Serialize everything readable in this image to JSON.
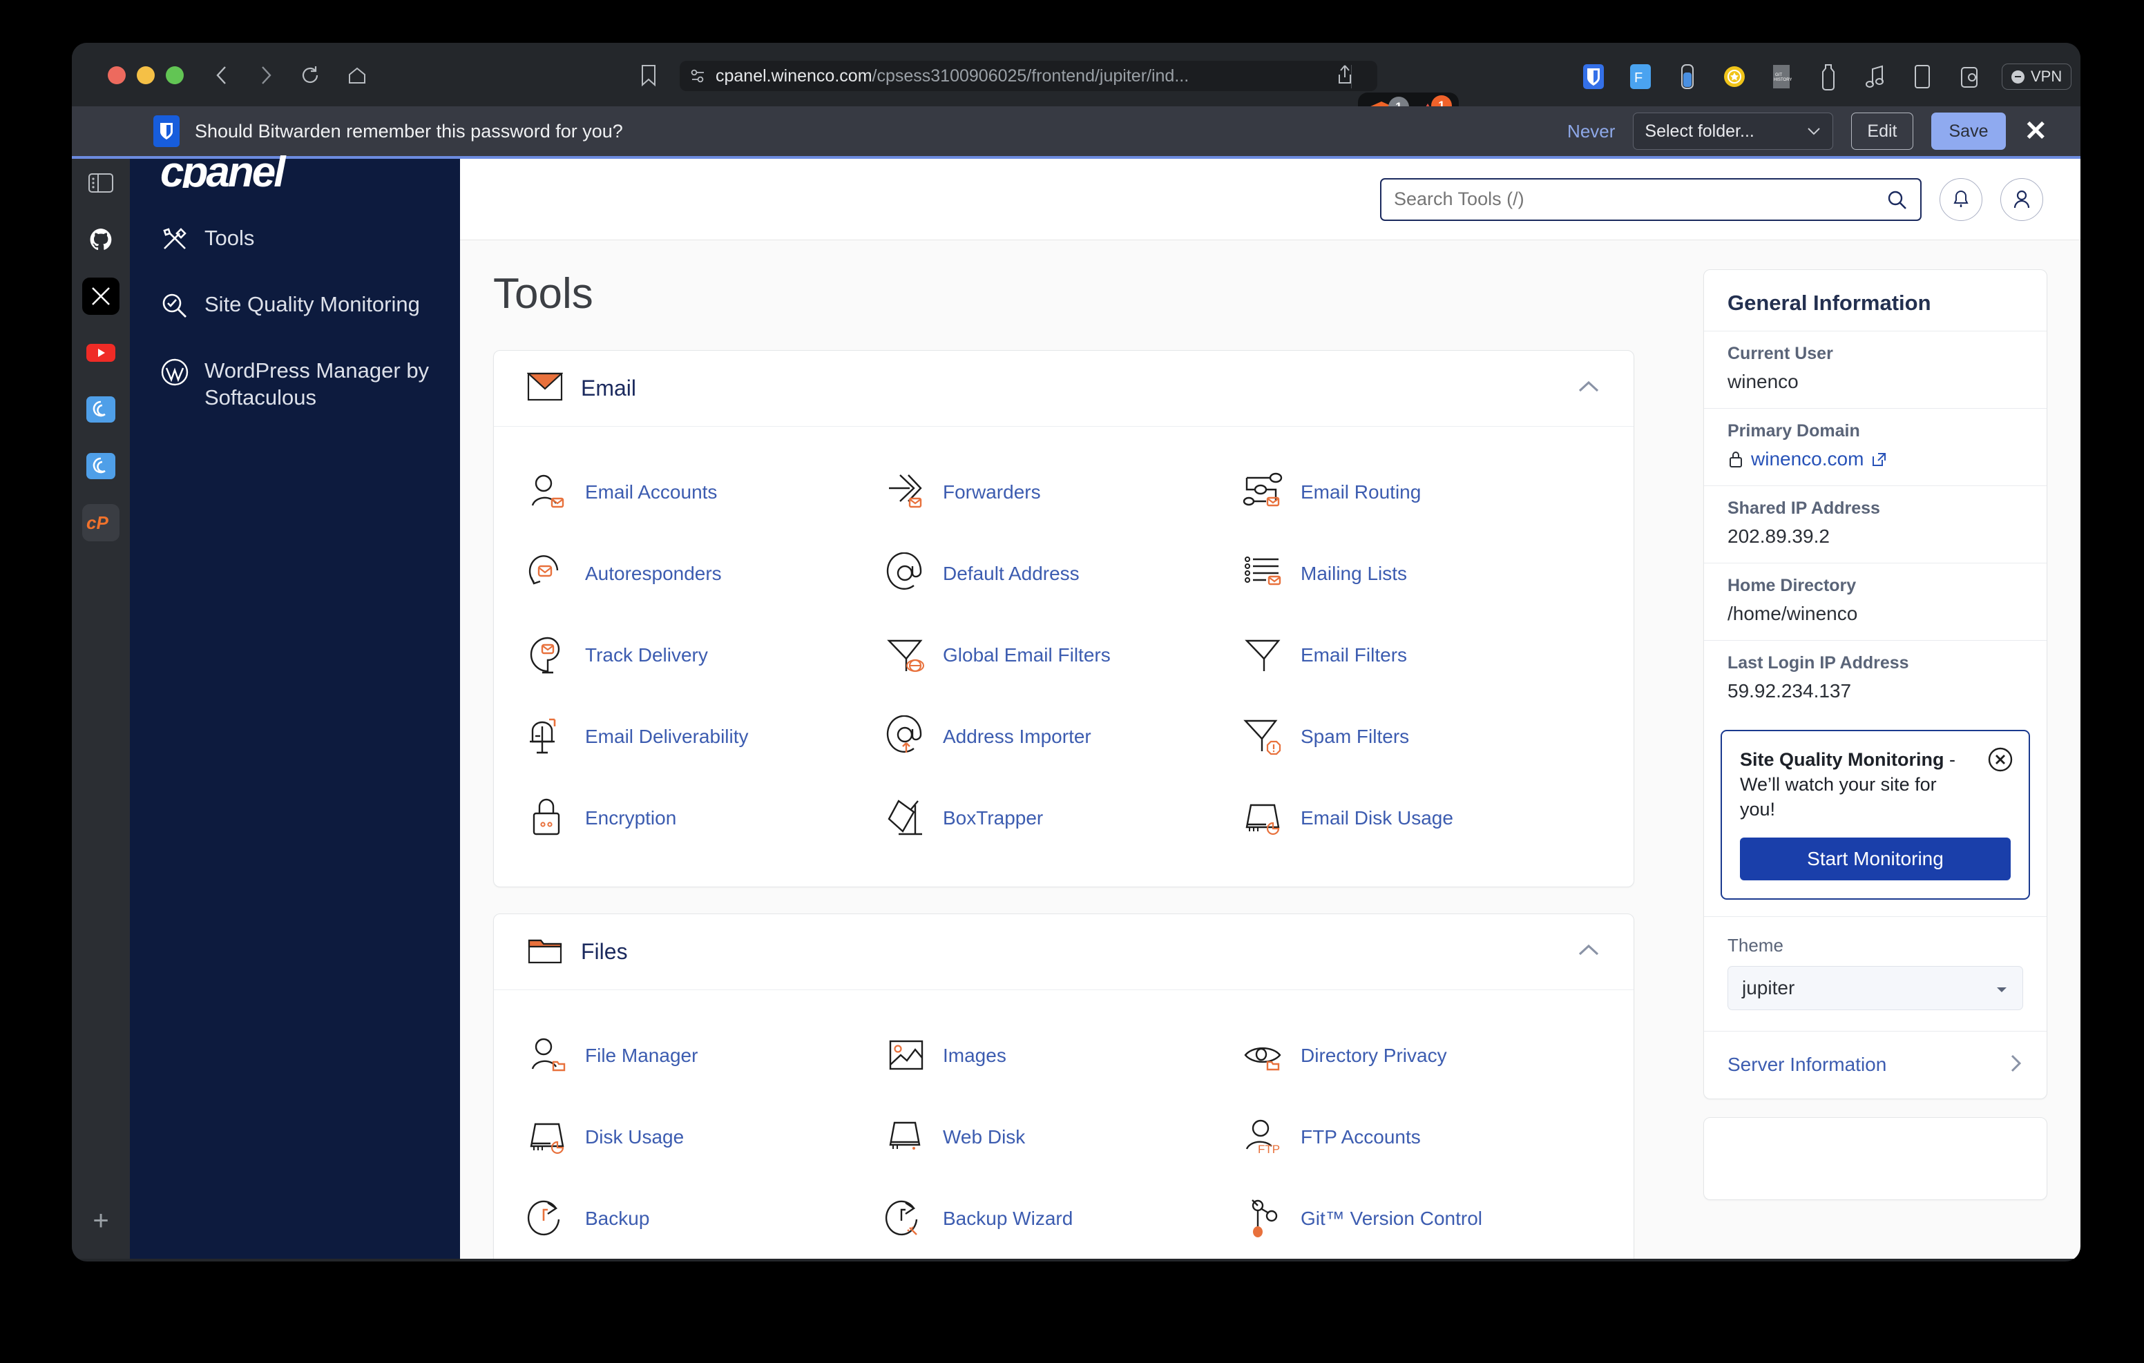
{
  "browser": {
    "url_main": "cpanel.winenco.com",
    "url_path": "/cpsess3100906025/frontend/jupiter/ind...",
    "nav": {
      "back": "‹",
      "forward": "›",
      "reload": "reload",
      "home": "home"
    },
    "brave_badge": "1",
    "rewards_badge": "1",
    "vpn_label": "VPN",
    "extensions": [
      "bitwarden-icon",
      "figma-icon",
      "bottle-icon",
      "coin-icon",
      "history-icon",
      "keeper-icon",
      "music-icon",
      "tablet-icon",
      "cookie-icon"
    ]
  },
  "bitwarden": {
    "message": "Should Bitwarden remember this password for you?",
    "never_label": "Never",
    "folder_placeholder": "Select folder...",
    "edit_label": "Edit",
    "save_label": "Save",
    "close_label": "✕"
  },
  "vertical_sidebar": {
    "items": [
      {
        "name": "sidebar-toggle-icon",
        "glyph": "▥",
        "active": false
      },
      {
        "name": "github-icon",
        "glyph": "github",
        "active": false
      },
      {
        "name": "x-twitter-icon",
        "glyph": "𝕏",
        "active": false
      },
      {
        "name": "youtube-icon",
        "glyph": "▶",
        "active": false
      },
      {
        "name": "perplexity-icon",
        "glyph": "◎",
        "active": false
      },
      {
        "name": "perplexity-icon-2",
        "glyph": "◎",
        "active": false
      },
      {
        "name": "cpanel-icon",
        "glyph": "cP",
        "active": true
      }
    ],
    "add_label": "+"
  },
  "cpanel_nav": {
    "logo": "cpanel",
    "items": [
      {
        "label": "Tools",
        "icon": "tools-icon"
      },
      {
        "label": "Site Quality Monitoring",
        "icon": "site-quality-icon"
      },
      {
        "label": "WordPress Manager by Softaculous",
        "icon": "wordpress-icon"
      }
    ]
  },
  "header": {
    "search_placeholder": "Search Tools (/)",
    "search_value": "",
    "notifications_icon": "bell-icon",
    "account_icon": "user-icon"
  },
  "page": {
    "title": "Tools"
  },
  "sections": [
    {
      "title": "Email",
      "icon": "envelope-icon",
      "collapse": "chevron-up-icon",
      "tools": [
        {
          "label": "Email Accounts",
          "icon": "email-accounts-icon"
        },
        {
          "label": "Forwarders",
          "icon": "forwarders-icon"
        },
        {
          "label": "Email Routing",
          "icon": "email-routing-icon"
        },
        {
          "label": "Autoresponders",
          "icon": "autoresponders-icon"
        },
        {
          "label": "Default Address",
          "icon": "default-address-icon"
        },
        {
          "label": "Mailing Lists",
          "icon": "mailing-lists-icon"
        },
        {
          "label": "Track Delivery",
          "icon": "track-delivery-icon"
        },
        {
          "label": "Global Email Filters",
          "icon": "global-email-filters-icon"
        },
        {
          "label": "Email Filters",
          "icon": "email-filters-icon"
        },
        {
          "label": "Email Deliverability",
          "icon": "email-deliverability-icon"
        },
        {
          "label": "Address Importer",
          "icon": "address-importer-icon"
        },
        {
          "label": "Spam Filters",
          "icon": "spam-filters-icon"
        },
        {
          "label": "Encryption",
          "icon": "encryption-icon"
        },
        {
          "label": "BoxTrapper",
          "icon": "boxtrapper-icon"
        },
        {
          "label": "Email Disk Usage",
          "icon": "email-disk-usage-icon"
        }
      ]
    },
    {
      "title": "Files",
      "icon": "folder-icon",
      "collapse": "chevron-up-icon",
      "tools": [
        {
          "label": "File Manager",
          "icon": "file-manager-icon"
        },
        {
          "label": "Images",
          "icon": "images-icon"
        },
        {
          "label": "Directory Privacy",
          "icon": "directory-privacy-icon"
        },
        {
          "label": "Disk Usage",
          "icon": "disk-usage-icon"
        },
        {
          "label": "Web Disk",
          "icon": "web-disk-icon"
        },
        {
          "label": "FTP Accounts",
          "icon": "ftp-accounts-icon"
        },
        {
          "label": "Backup",
          "icon": "backup-icon"
        },
        {
          "label": "Backup Wizard",
          "icon": "backup-wizard-icon"
        },
        {
          "label": "Git™ Version Control",
          "icon": "git-version-control-icon"
        }
      ]
    }
  ],
  "general_information": {
    "title": "General Information",
    "rows": [
      {
        "key": "Current User",
        "value": "winenco"
      },
      {
        "key": "Primary Domain",
        "value": "winenco.com",
        "link": true,
        "lock": true,
        "external": true
      },
      {
        "key": "Shared IP Address",
        "value": "202.89.39.2"
      },
      {
        "key": "Home Directory",
        "value": "/home/winenco"
      },
      {
        "key": "Last Login IP Address",
        "value": "59.92.234.137"
      }
    ]
  },
  "promo": {
    "title": "Site Quality Monitoring",
    "dash": " - ",
    "subtitle": "We’ll watch your site for you!",
    "button": "Start Monitoring",
    "close_icon": "close-circle-icon"
  },
  "theme": {
    "label": "Theme",
    "value": "jupiter"
  },
  "server_information": {
    "label": "Server Information",
    "chevron": "chevron-right-icon"
  },
  "colors": {
    "cpanel_navy": "#0d1b3e",
    "accent_orange": "#e8713c",
    "link_blue": "#3c5cb0",
    "promo_blue": "#1a3faa",
    "bitwarden_blue": "#175ddc"
  }
}
